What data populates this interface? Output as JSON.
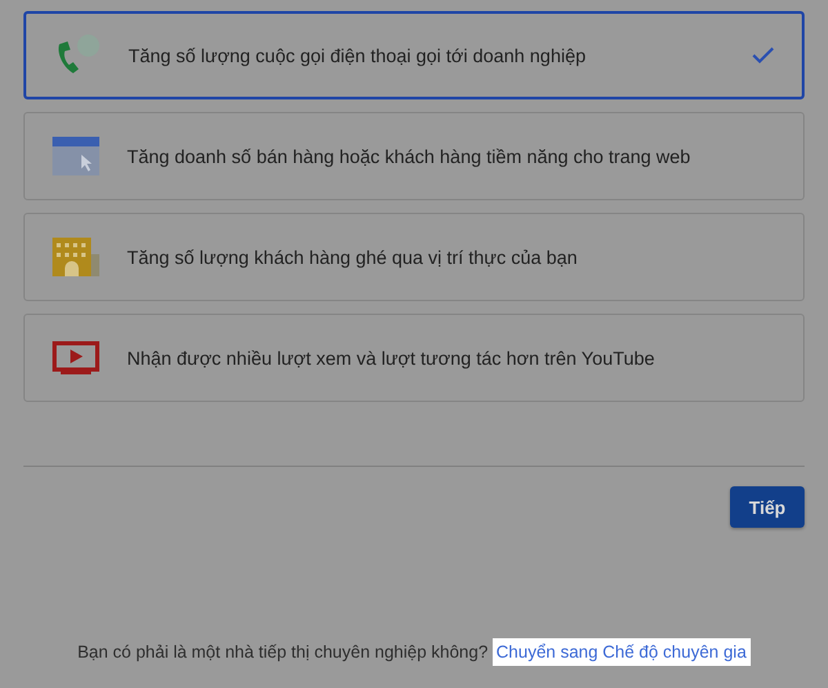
{
  "options": [
    {
      "kind": "phone",
      "label": "Tăng số lượng cuộc gọi điện thoại gọi tới doanh nghiệp",
      "selected": true
    },
    {
      "kind": "web",
      "label": "Tăng doanh số bán hàng hoặc khách hàng tiềm năng cho trang web",
      "selected": false
    },
    {
      "kind": "store",
      "label": "Tăng số lượng khách hàng ghé qua vị trí thực của bạn",
      "selected": false
    },
    {
      "kind": "video",
      "label": "Nhận được nhiều lượt xem và lượt tương tác hơn trên YouTube",
      "selected": false
    }
  ],
  "next_button": "Tiếp",
  "footer": {
    "question": "Bạn có phải là một nhà tiếp thị chuyên nghiệp không?",
    "link": "Chuyển sang Chế độ chuyên gia"
  }
}
